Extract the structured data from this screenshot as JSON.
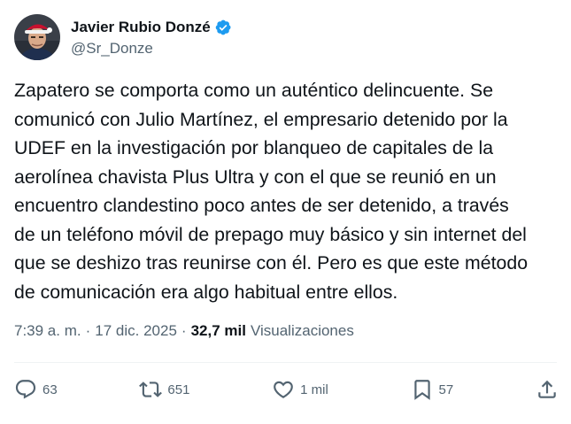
{
  "author": {
    "display_name": "Javier Rubio Donzé",
    "handle": "@Sr_Donze",
    "verified": true,
    "verified_color": "#1d9bf0"
  },
  "tweet": {
    "text": "Zapatero se comporta como un auténtico delincuente. Se\ncomunicó con Julio Martínez, el empresario detenido por la\nUDEF en la investigación por blanqueo de capitales de la\naerolínea chavista Plus Ultra y con el que se reunió en un\nencuentro clandestino poco antes de ser detenido, a través\nde un teléfono móvil de prepago muy básico y sin internet del\nque se deshizo tras reunirse con él. Pero es que este método\nde comunicación era algo habitual entre ellos."
  },
  "meta": {
    "time": "7:39 a. m.",
    "separator": "·",
    "date": "17 dic. 2025",
    "views_count": "32,7 mil",
    "views_label": "Visualizaciones"
  },
  "actions": {
    "reply": {
      "icon": "reply-icon",
      "count": "63"
    },
    "retweet": {
      "icon": "retweet-icon",
      "count": "651"
    },
    "like": {
      "icon": "heart-icon",
      "count": "1 mil"
    },
    "bookmark": {
      "icon": "bookmark-icon",
      "count": "57"
    },
    "share": {
      "icon": "share-icon"
    }
  },
  "colors": {
    "text_primary": "#0f1419",
    "text_secondary": "#536471",
    "divider": "#eff3f4",
    "background": "#ffffff"
  }
}
